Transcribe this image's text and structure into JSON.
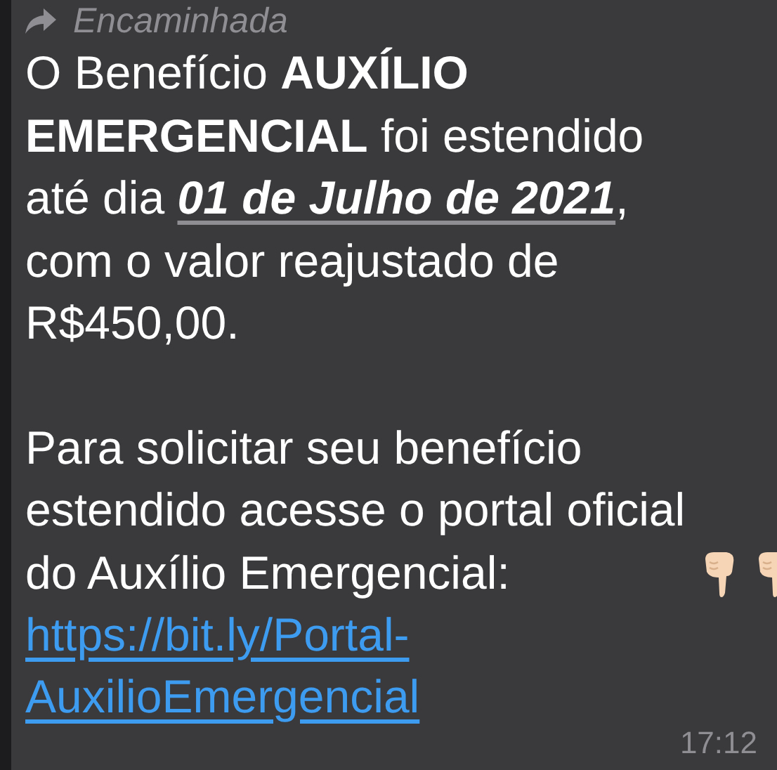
{
  "forwarded_label": "Encaminhada",
  "paragraphs": [
    {
      "lines": [
        "O Benefício **AUXÍLIO**",
        "**EMERGENCIAL** foi estendido",
        "até dia *01 de Julho de 2021*,",
        "com o valor reajustado de",
        "R$450,00."
      ]
    },
    {
      "lines": [
        "Para solicitar seu benefício",
        "estendido acesse o portal oficial",
        "do Auxílio Emergencial:"
      ]
    }
  ],
  "emojis": [
    {
      "kind": "pointing-down"
    },
    {
      "kind": "pointing-down"
    }
  ],
  "link": {
    "lines": [
      "https://bit.ly/Portal-",
      "AuxilioEmergencial"
    ]
  },
  "time": "17:12"
}
